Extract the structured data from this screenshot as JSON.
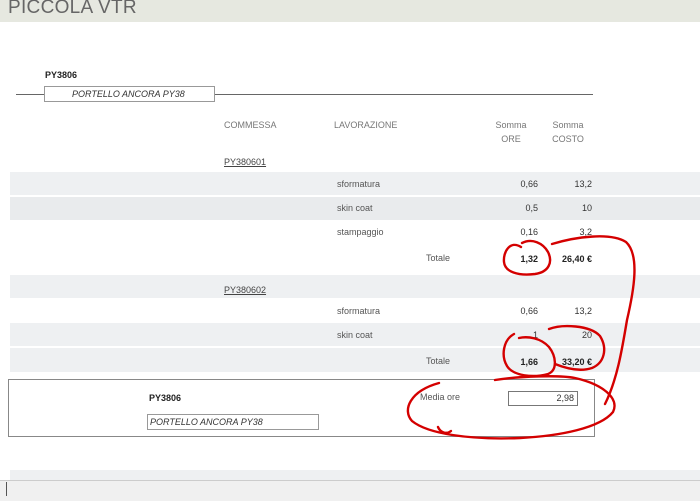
{
  "app": {
    "title": "PICCOLA VTR"
  },
  "header": {
    "code": "PY3806",
    "description": "PORTELLO ANCORA PY38"
  },
  "columns": {
    "commessa": "COMMESSA",
    "lavorazione": "LAVORAZIONE",
    "ore_1": "Somma",
    "ore_2": "ORE",
    "costo_1": "Somma",
    "costo_2": "COSTO"
  },
  "groups": [
    {
      "commessa": "PY380601",
      "rows": [
        {
          "lavorazione": "sformatura",
          "ore": "0,66",
          "costo": "13,2"
        },
        {
          "lavorazione": "skin coat",
          "ore": "0,5",
          "costo": "10"
        },
        {
          "lavorazione": "stampaggio",
          "ore": "0,16",
          "costo": "3,2"
        }
      ],
      "totale_label": "Totale",
      "totale_ore": "1,32",
      "totale_costo": "26,40 €"
    },
    {
      "commessa": "PY380602",
      "rows": [
        {
          "lavorazione": "sformatura",
          "ore": "0,66",
          "costo": "13,2"
        },
        {
          "lavorazione": "skin coat",
          "ore": "1",
          "costo": "20"
        }
      ],
      "totale_label": "Totale",
      "totale_ore": "1,66",
      "totale_costo": "33,20 €"
    }
  ],
  "summary": {
    "code": "PY3806",
    "description": "PORTELLO ANCORA PY38",
    "media_label": "Media ore",
    "media_value": "2,98"
  },
  "colors": {
    "title_band": "#e6e8e0",
    "row_band": "#eef0f2",
    "annotation": "#d40000"
  }
}
